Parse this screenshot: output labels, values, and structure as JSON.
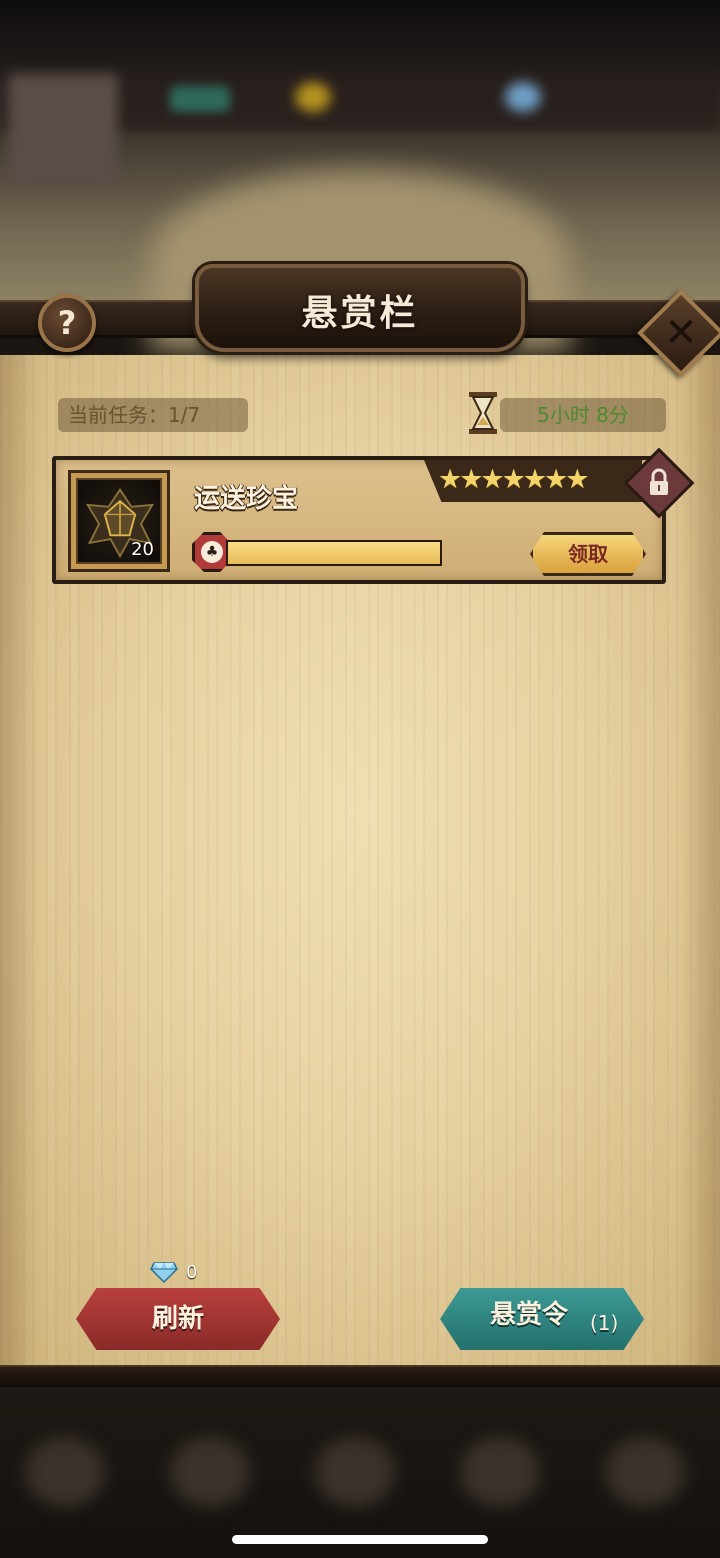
{
  "header": {
    "title": "悬赏栏"
  },
  "help_button": {
    "glyph": "?"
  },
  "close_button": {
    "glyph": "✕"
  },
  "status": {
    "task_count_label": "当前任务：",
    "task_count_value": "1/7",
    "time_remaining": "5小时 8分"
  },
  "task": {
    "name": "运送珍宝",
    "reward_item_count": "20",
    "stars_display": "★★★★★★★",
    "star_rating": 7,
    "progress_fraction": 1.0,
    "claim_label": "领取",
    "locked": true
  },
  "footer": {
    "gem_count": "0",
    "refresh_label": "刷新",
    "bounty_order_label": "悬赏令",
    "bounty_order_count": "(1)"
  },
  "colors": {
    "refresh": "#b8403d",
    "bounty_order": "#3d9a95",
    "timer_text": "#4f8a2e",
    "stars": "#f3d46a"
  }
}
